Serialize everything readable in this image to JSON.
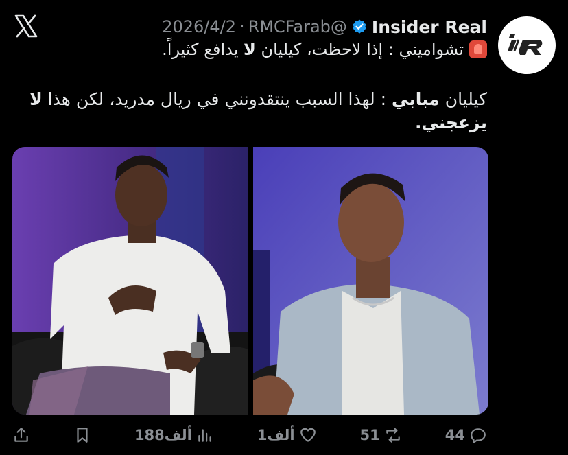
{
  "header": {
    "display_name": "Insider Real",
    "handle": "@RMCFarab",
    "separator": "·",
    "date": "2026/4/2"
  },
  "tweet": {
    "line1_plain": "تشواميني : إذا لاحظت، كيليان ",
    "line1_bold": "لا",
    "line1_end": " يدافع كثيراً.",
    "quote_start": "كيليان ",
    "quote_bold1": "مبابي",
    "quote_mid": " : لهذا السبب ينتقدونني في ريال مدريد، لكن هذا ",
    "quote_bold2": "لا يزعجني."
  },
  "actions": {
    "replies": "44",
    "reposts": "51",
    "likes": "1ألف",
    "views": "188ألف"
  },
  "icons": {
    "x_logo": "x-logo-icon",
    "verified": "verified-badge-icon",
    "siren": "rotating-light-icon",
    "reply": "reply-icon",
    "repost": "repost-icon",
    "like": "heart-icon",
    "views": "views-icon",
    "bookmark": "bookmark-icon",
    "share": "share-icon"
  },
  "colors": {
    "background": "#000000",
    "text": "#e7e9ea",
    "muted": "#8b8f94",
    "verified": "#1d9bf0"
  }
}
